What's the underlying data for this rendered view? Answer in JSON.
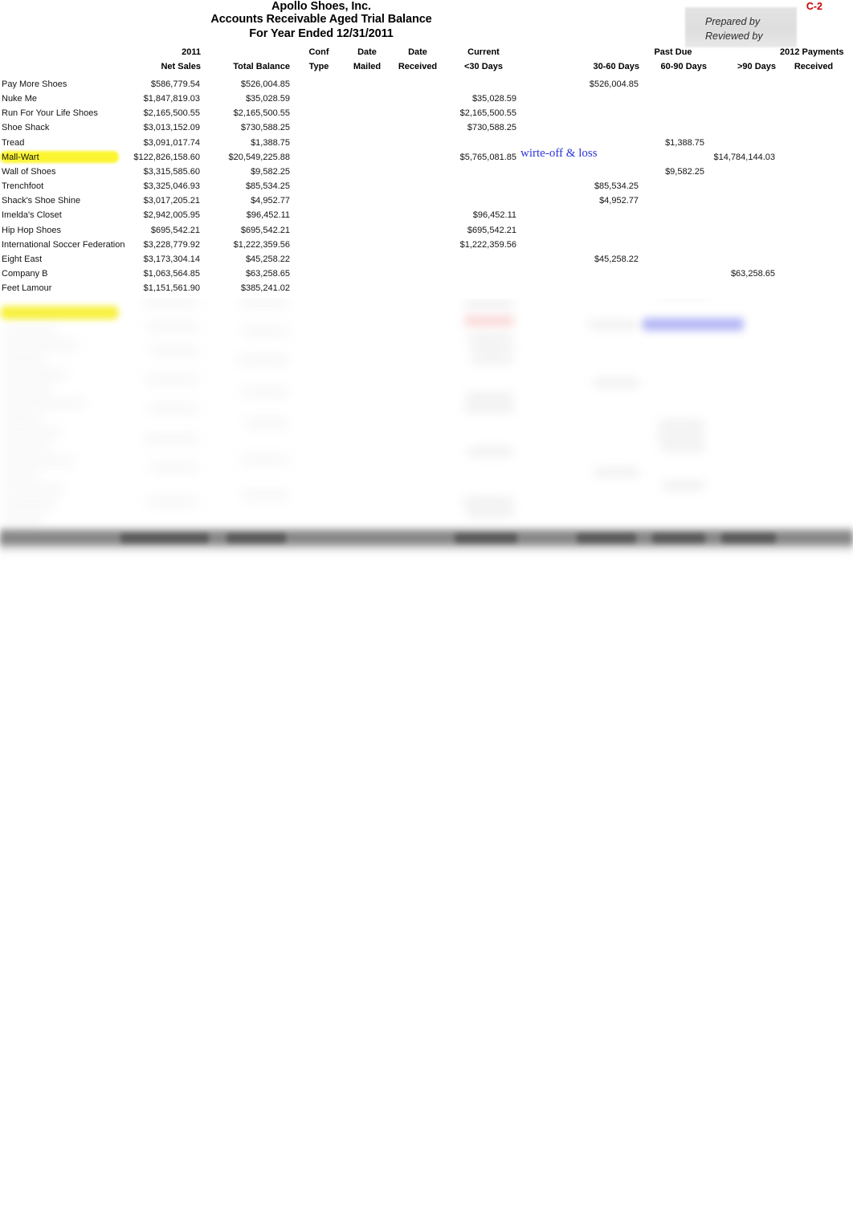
{
  "document": {
    "company": "Apollo Shoes, Inc.",
    "report_title": "Accounts Receivable Aged Trial Balance",
    "period": "For Year Ended 12/31/2011",
    "index_reference": "C-2",
    "signoff": {
      "prepared_by_label": "Prepared by",
      "reviewed_by_label": "Reviewed by"
    }
  },
  "annotations": [
    {
      "text": "wirte-off & loss",
      "color": "#2b34d6",
      "attached_to_row": "Mall-Wart",
      "style": "handwritten-blue-serif"
    }
  ],
  "highlights": [
    {
      "color": "#fbf520",
      "target": "Mall-Wart",
      "kind": "row-label-highlight"
    },
    {
      "color": "#fbf520",
      "target": "redacted-row",
      "kind": "row-label-highlight"
    }
  ],
  "headers": {
    "line1": {
      "year": "2011",
      "conf": "Conf",
      "date_mailed": "Date",
      "date_received": "Date",
      "current": "Current",
      "past_due": "Past Due",
      "payments_2012": "2012 Payments"
    },
    "line2": {
      "net_sales": "Net Sales",
      "total_balance": "Total Balance",
      "conf_type": "Type",
      "mailed": "Mailed",
      "received": "Received",
      "under_30": "<30 Days",
      "d30_60": "30-60 Days",
      "d60_90": "60-90 Days",
      "over_90": ">90 Days",
      "payments_received": "Received"
    }
  },
  "chart_data": {
    "type": "table",
    "title": "Accounts Receivable Aged Trial Balance",
    "columns": [
      "Customer",
      "2011 Net Sales",
      "Total Balance",
      "Conf Type",
      "Date Mailed",
      "Date Received",
      "Current <30 Days",
      "30-60 Days",
      "60-90 Days",
      ">90 Days",
      "2012 Payments Received"
    ],
    "rows": [
      {
        "name": "Pay More Shoes",
        "net_sales": "$586,779.54",
        "total_balance": "$526,004.85",
        "conf": "",
        "mailed": "",
        "received": "",
        "u30": "",
        "d3060": "$526,004.85",
        "d6090": "",
        "d90": "",
        "pay2012": "",
        "highlight": false
      },
      {
        "name": "Nuke Me",
        "net_sales": "$1,847,819.03",
        "total_balance": "$35,028.59",
        "conf": "",
        "mailed": "",
        "received": "",
        "u30": "$35,028.59",
        "d3060": "",
        "d6090": "",
        "d90": "",
        "pay2012": "",
        "highlight": false
      },
      {
        "name": "Run For Your Life Shoes",
        "net_sales": "$2,165,500.55",
        "total_balance": "$2,165,500.55",
        "conf": "",
        "mailed": "",
        "received": "",
        "u30": "$2,165,500.55",
        "d3060": "",
        "d6090": "",
        "d90": "",
        "pay2012": "",
        "highlight": false
      },
      {
        "name": "Shoe Shack",
        "net_sales": "$3,013,152.09",
        "total_balance": "$730,588.25",
        "conf": "",
        "mailed": "",
        "received": "",
        "u30": "$730,588.25",
        "d3060": "",
        "d6090": "",
        "d90": "",
        "pay2012": "",
        "highlight": false
      },
      {
        "name": "Tread",
        "net_sales": "$3,091,017.74",
        "total_balance": "$1,388.75",
        "conf": "",
        "mailed": "",
        "received": "",
        "u30": "",
        "d3060": "",
        "d6090": "$1,388.75",
        "d90": "",
        "pay2012": "",
        "highlight": false
      },
      {
        "name": "Mall-Wart",
        "net_sales": "$122,826,158.60",
        "total_balance": "$20,549,225.88",
        "conf": "",
        "mailed": "",
        "received": "",
        "u30": "$5,765,081.85",
        "d3060": "",
        "d6090": "",
        "d90": "$14,784,144.03",
        "pay2012": "",
        "highlight": true
      },
      {
        "name": "Wall of Shoes",
        "net_sales": "$3,315,585.60",
        "total_balance": "$9,582.25",
        "conf": "",
        "mailed": "",
        "received": "",
        "u30": "",
        "d3060": "",
        "d6090": "$9,582.25",
        "d90": "",
        "pay2012": "",
        "highlight": false
      },
      {
        "name": "Trenchfoot",
        "net_sales": "$3,325,046.93",
        "total_balance": "$85,534.25",
        "conf": "",
        "mailed": "",
        "received": "",
        "u30": "",
        "d3060": "$85,534.25",
        "d6090": "",
        "d90": "",
        "pay2012": "",
        "highlight": false
      },
      {
        "name": "Shack's Shoe Shine",
        "net_sales": "$3,017,205.21",
        "total_balance": "$4,952.77",
        "conf": "",
        "mailed": "",
        "received": "",
        "u30": "",
        "d3060": "$4,952.77",
        "d6090": "",
        "d90": "",
        "pay2012": "",
        "highlight": false
      },
      {
        "name": "Imelda's Closet",
        "net_sales": "$2,942,005.95",
        "total_balance": "$96,452.11",
        "conf": "",
        "mailed": "",
        "received": "",
        "u30": "$96,452.11",
        "d3060": "",
        "d6090": "",
        "d90": "",
        "pay2012": "",
        "highlight": false
      },
      {
        "name": "Hip Hop Shoes",
        "net_sales": "$695,542.21",
        "total_balance": "$695,542.21",
        "conf": "",
        "mailed": "",
        "received": "",
        "u30": "$695,542.21",
        "d3060": "",
        "d6090": "",
        "d90": "",
        "pay2012": "",
        "highlight": false
      },
      {
        "name": "International Soccer Federation",
        "net_sales": "$3,228,779.92",
        "total_balance": "$1,222,359.56",
        "conf": "",
        "mailed": "",
        "received": "",
        "u30": "$1,222,359.56",
        "d3060": "",
        "d6090": "",
        "d90": "",
        "pay2012": "",
        "highlight": false
      },
      {
        "name": "Eight East",
        "net_sales": "$3,173,304.14",
        "total_balance": "$45,258.22",
        "conf": "",
        "mailed": "",
        "received": "",
        "u30": "",
        "d3060": "$45,258.22",
        "d6090": "",
        "d90": "",
        "pay2012": "",
        "highlight": false
      },
      {
        "name": "Company B",
        "net_sales": "$1,063,564.85",
        "total_balance": "$63,258.65",
        "conf": "",
        "mailed": "",
        "received": "",
        "u30": "",
        "d3060": "",
        "d6090": "",
        "d90": "$63,258.65",
        "pay2012": "",
        "highlight": false
      },
      {
        "name": "Feet Lamour",
        "net_sales": "$1,151,561.90",
        "total_balance": "$385,241.02",
        "conf": "",
        "mailed": "",
        "received": "",
        "u30": "",
        "d3060": "",
        "d6090": "",
        "d90": "",
        "pay2012": "",
        "highlight": false
      }
    ],
    "note": "Rows below 'Feet Lamour' and the totals band are blurred/illegible in the source image."
  }
}
